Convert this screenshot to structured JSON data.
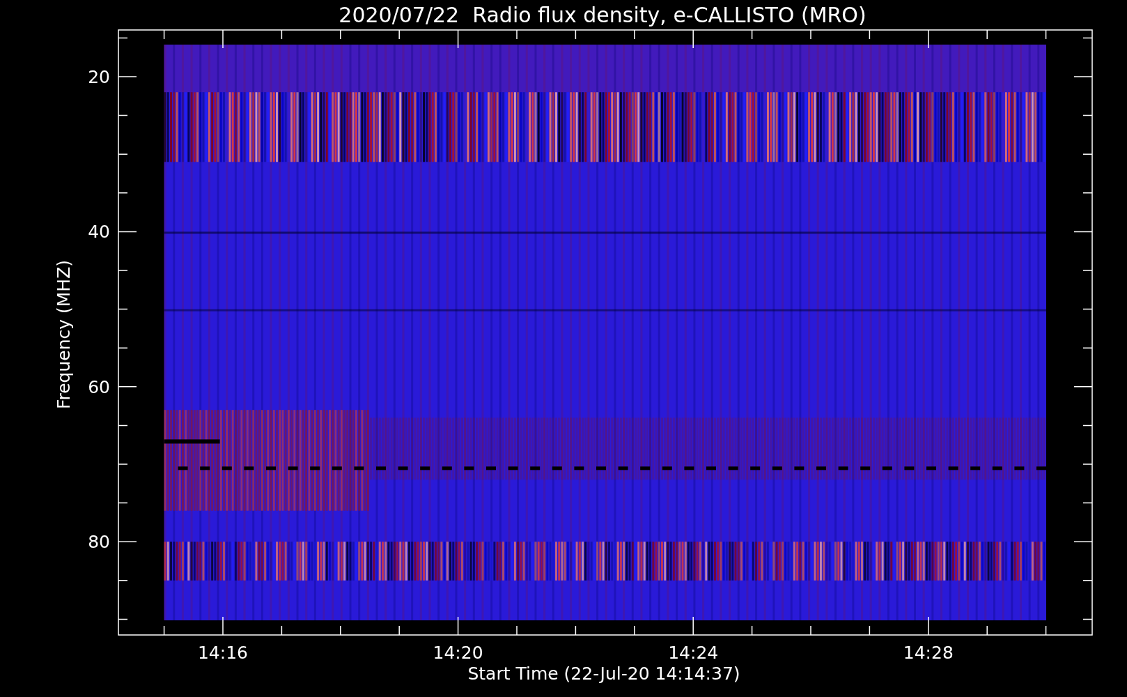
{
  "title": "2020/07/22  Radio flux density, e-CALLISTO (MRO)",
  "y_axis": {
    "label": "Frequency (MHZ)",
    "ticks": [
      "20",
      "40",
      "60",
      "80"
    ]
  },
  "x_axis": {
    "label": "Start Time (22-Jul-20 14:14:37)",
    "ticks": [
      "14:16",
      "14:20",
      "14:24",
      "14:28"
    ]
  }
}
